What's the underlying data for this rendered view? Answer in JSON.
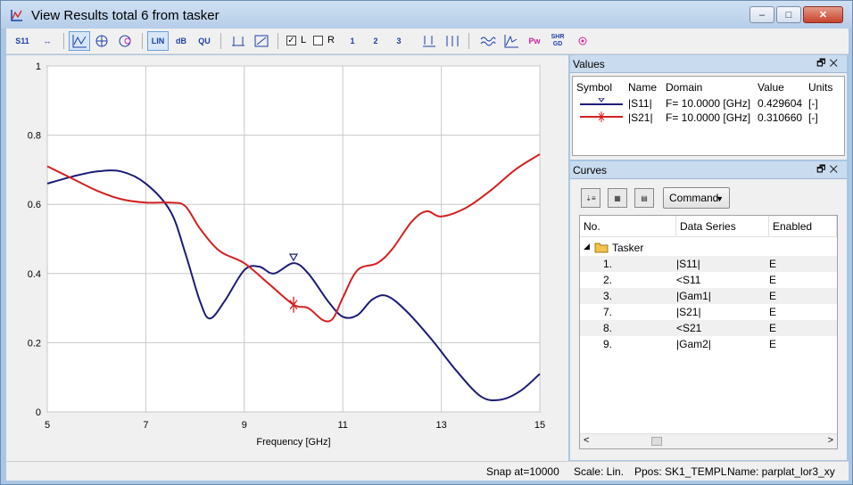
{
  "window": {
    "title": "View Results total 6 from tasker",
    "icon": "chart-app-icon",
    "controls": {
      "minimize": "–",
      "maximize": "□",
      "close": "✕"
    }
  },
  "toolbar": {
    "checkbox_l": {
      "label": "L",
      "checked": true
    },
    "checkbox_r": {
      "label": "R",
      "checked": false
    },
    "buttons": {
      "s11": "S11",
      "fit": "↔",
      "lin": "LIN",
      "db": "dB",
      "qu": "QU",
      "one": "1",
      "two": "2",
      "three": "3",
      "shr": "SHR",
      "gd": "GD",
      "pw": "Pw"
    }
  },
  "chart_data": {
    "type": "line",
    "xlabel": "Frequency [GHz]",
    "ylabel": "",
    "xlim": [
      5,
      15
    ],
    "ylim": [
      0,
      1
    ],
    "xticks": [
      5,
      7,
      9,
      11,
      13,
      15
    ],
    "yticks": [
      0,
      0.2,
      0.4,
      0.6,
      0.8,
      1
    ],
    "grid": true,
    "marker_x": 10,
    "series": [
      {
        "name": "|S11|",
        "color": "#1c1c78",
        "points": [
          [
            5,
            0.66
          ],
          [
            5.5,
            0.68
          ],
          [
            6,
            0.695
          ],
          [
            6.5,
            0.695
          ],
          [
            7,
            0.66
          ],
          [
            7.5,
            0.58
          ],
          [
            7.8,
            0.46
          ],
          [
            8.1,
            0.32
          ],
          [
            8.3,
            0.27
          ],
          [
            8.6,
            0.32
          ],
          [
            9,
            0.41
          ],
          [
            9.3,
            0.42
          ],
          [
            9.6,
            0.4
          ],
          [
            10,
            0.43
          ],
          [
            10.3,
            0.4
          ],
          [
            10.7,
            0.32
          ],
          [
            11,
            0.275
          ],
          [
            11.3,
            0.28
          ],
          [
            11.6,
            0.325
          ],
          [
            11.9,
            0.335
          ],
          [
            12.3,
            0.29
          ],
          [
            12.8,
            0.21
          ],
          [
            13.3,
            0.12
          ],
          [
            13.8,
            0.045
          ],
          [
            14.2,
            0.035
          ],
          [
            14.6,
            0.06
          ],
          [
            15,
            0.11
          ]
        ]
      },
      {
        "name": "|S21|",
        "color": "#d42020",
        "points": [
          [
            5,
            0.71
          ],
          [
            5.5,
            0.675
          ],
          [
            6,
            0.64
          ],
          [
            6.5,
            0.615
          ],
          [
            7,
            0.605
          ],
          [
            7.5,
            0.605
          ],
          [
            7.8,
            0.595
          ],
          [
            8.1,
            0.53
          ],
          [
            8.5,
            0.465
          ],
          [
            9,
            0.43
          ],
          [
            9.5,
            0.37
          ],
          [
            10,
            0.31
          ],
          [
            10.3,
            0.3
          ],
          [
            10.6,
            0.265
          ],
          [
            10.8,
            0.27
          ],
          [
            11,
            0.33
          ],
          [
            11.3,
            0.41
          ],
          [
            11.7,
            0.43
          ],
          [
            12,
            0.47
          ],
          [
            12.4,
            0.55
          ],
          [
            12.7,
            0.58
          ],
          [
            13,
            0.565
          ],
          [
            13.5,
            0.59
          ],
          [
            14,
            0.64
          ],
          [
            14.5,
            0.7
          ],
          [
            15,
            0.745
          ]
        ]
      }
    ]
  },
  "values_panel": {
    "title": "Values",
    "columns": [
      "Symbol",
      "Name",
      "Domain",
      "Value",
      "Units"
    ],
    "rows": [
      {
        "name": "|S11|",
        "domain": "F= 10.0000 [GHz]",
        "value": "0.429604",
        "units": "[-]",
        "color": "#1c1c78"
      },
      {
        "name": "|S21|",
        "domain": "F= 10.0000 [GHz]",
        "value": "0.310660",
        "units": "[-]",
        "color": "#d42020"
      }
    ]
  },
  "curves_panel": {
    "title": "Curves",
    "command_label": "Command",
    "columns": [
      "No.",
      "Data Series",
      "Enabled"
    ],
    "folder": "Tasker",
    "rows": [
      {
        "no": "1.",
        "series": "|S11|",
        "enabled": "E"
      },
      {
        "no": "2.",
        "series": "<S11",
        "enabled": "E"
      },
      {
        "no": "3.",
        "series": "|Gam1|",
        "enabled": "E"
      },
      {
        "no": "7.",
        "series": "|S21|",
        "enabled": "E"
      },
      {
        "no": "8.",
        "series": "<S21",
        "enabled": "E"
      },
      {
        "no": "9.",
        "series": "|Gam2|",
        "enabled": "E"
      }
    ]
  },
  "status": {
    "snap": "Snap at=10000",
    "scale": "Scale: Lin.",
    "ppos": "Ppos: SK1_TEMPL",
    "name": "Name: parplat_lor3_xy"
  }
}
